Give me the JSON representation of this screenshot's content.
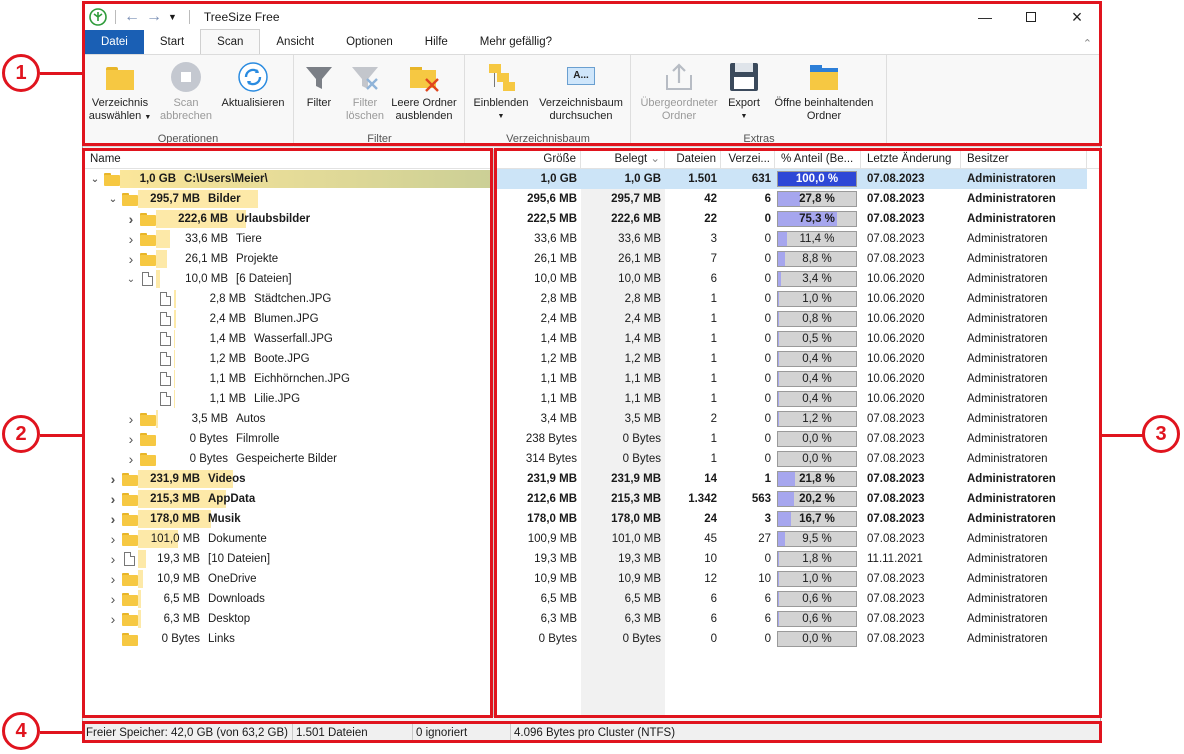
{
  "window": {
    "title": "TreeSize Free"
  },
  "tabs": [
    "Datei",
    "Start",
    "Scan",
    "Ansicht",
    "Optionen",
    "Hilfe",
    "Mehr gefällig?"
  ],
  "ribbon": {
    "groups": {
      "operationen": "Operationen",
      "filter": "Filter",
      "verzeichnisbaum": "Verzeichnisbaum",
      "extras": "Extras"
    },
    "buttons": {
      "verzeichnis_l1": "Verzeichnis",
      "verzeichnis_l2": "auswählen",
      "scan_l1": "Scan",
      "scan_l2": "abbrechen",
      "aktualisieren": "Aktualisieren",
      "filter": "Filter",
      "filter_loeschen_l1": "Filter",
      "filter_loeschen_l2": "löschen",
      "leere_l1": "Leere Ordner",
      "leere_l2": "ausblenden",
      "einblenden": "Einblenden",
      "vz_durchsuchen_l1": "Verzeichnisbaum",
      "vz_durchsuchen_l2": "durchsuchen",
      "uebergeordnet_l1": "Übergeordneter",
      "uebergeordnet_l2": "Ordner",
      "export": "Export",
      "oeffne_l1": "Öffne beinhaltenden",
      "oeffne_l2": "Ordner"
    }
  },
  "tree": {
    "header": "Name",
    "rows": [
      {
        "size": "1,0 GB",
        "name": "C:\\Users\\Meier\\",
        "bold": true
      },
      {
        "size": "295,7 MB",
        "name": "Bilder",
        "bold": true
      },
      {
        "size": "222,6 MB",
        "name": "Urlaubsbilder",
        "bold": true
      },
      {
        "size": "33,6 MB",
        "name": "Tiere"
      },
      {
        "size": "26,1 MB",
        "name": "Projekte"
      },
      {
        "size": "10,0 MB",
        "name": "[6 Dateien]"
      },
      {
        "size": "2,8 MB",
        "name": "Städtchen.JPG"
      },
      {
        "size": "2,4 MB",
        "name": "Blumen.JPG"
      },
      {
        "size": "1,4 MB",
        "name": "Wasserfall.JPG"
      },
      {
        "size": "1,2 MB",
        "name": "Boote.JPG"
      },
      {
        "size": "1,1 MB",
        "name": "Eichhörnchen.JPG"
      },
      {
        "size": "1,1 MB",
        "name": "Lilie.JPG"
      },
      {
        "size": "3,5 MB",
        "name": "Autos"
      },
      {
        "size": "0 Bytes",
        "name": "Filmrolle"
      },
      {
        "size": "0 Bytes",
        "name": "Gespeicherte Bilder"
      },
      {
        "size": "231,9 MB",
        "name": "Videos",
        "bold": true
      },
      {
        "size": "215,3 MB",
        "name": "AppData",
        "bold": true
      },
      {
        "size": "178,0 MB",
        "name": "Musik",
        "bold": true
      },
      {
        "size": "101,0 MB",
        "name": "Dokumente"
      },
      {
        "size": "19,3 MB",
        "name": "[10 Dateien]"
      },
      {
        "size": "10,9 MB",
        "name": "OneDrive"
      },
      {
        "size": "6,5 MB",
        "name": "Downloads"
      },
      {
        "size": "6,3 MB",
        "name": "Desktop"
      },
      {
        "size": "0 Bytes",
        "name": "Links"
      }
    ]
  },
  "grid": {
    "headers": [
      "Größe",
      "Belegt",
      "Dateien",
      "Verzei...",
      "% Anteil (Be...",
      "Letzte Änderung",
      "Besitzer"
    ],
    "rows": [
      [
        "1,0 GB",
        "1,0 GB",
        "1.501",
        "631",
        "100,0 %",
        "07.08.2023",
        "Administratoren"
      ],
      [
        "295,6 MB",
        "295,7 MB",
        "42",
        "6",
        "27,8 %",
        "07.08.2023",
        "Administratoren"
      ],
      [
        "222,5 MB",
        "222,6 MB",
        "22",
        "0",
        "75,3 %",
        "07.08.2023",
        "Administratoren"
      ],
      [
        "33,6 MB",
        "33,6 MB",
        "3",
        "0",
        "11,4 %",
        "07.08.2023",
        "Administratoren"
      ],
      [
        "26,1 MB",
        "26,1 MB",
        "7",
        "0",
        "8,8 %",
        "07.08.2023",
        "Administratoren"
      ],
      [
        "10,0 MB",
        "10,0 MB",
        "6",
        "0",
        "3,4 %",
        "10.06.2020",
        "Administratoren"
      ],
      [
        "2,8 MB",
        "2,8 MB",
        "1",
        "0",
        "1,0 %",
        "10.06.2020",
        "Administratoren"
      ],
      [
        "2,4 MB",
        "2,4 MB",
        "1",
        "0",
        "0,8 %",
        "10.06.2020",
        "Administratoren"
      ],
      [
        "1,4 MB",
        "1,4 MB",
        "1",
        "0",
        "0,5 %",
        "10.06.2020",
        "Administratoren"
      ],
      [
        "1,2 MB",
        "1,2 MB",
        "1",
        "0",
        "0,4 %",
        "10.06.2020",
        "Administratoren"
      ],
      [
        "1,1 MB",
        "1,1 MB",
        "1",
        "0",
        "0,4 %",
        "10.06.2020",
        "Administratoren"
      ],
      [
        "1,1 MB",
        "1,1 MB",
        "1",
        "0",
        "0,4 %",
        "10.06.2020",
        "Administratoren"
      ],
      [
        "3,4 MB",
        "3,5 MB",
        "2",
        "0",
        "1,2 %",
        "07.08.2023",
        "Administratoren"
      ],
      [
        "238 Bytes",
        "0 Bytes",
        "1",
        "0",
        "0,0 %",
        "07.08.2023",
        "Administratoren"
      ],
      [
        "314 Bytes",
        "0 Bytes",
        "1",
        "0",
        "0,0 %",
        "07.08.2023",
        "Administratoren"
      ],
      [
        "231,9 MB",
        "231,9 MB",
        "14",
        "1",
        "21,8 %",
        "07.08.2023",
        "Administratoren"
      ],
      [
        "212,6 MB",
        "215,3 MB",
        "1.342",
        "563",
        "20,2 %",
        "07.08.2023",
        "Administratoren"
      ],
      [
        "178,0 MB",
        "178,0 MB",
        "24",
        "3",
        "16,7 %",
        "07.08.2023",
        "Administratoren"
      ],
      [
        "100,9 MB",
        "101,0 MB",
        "45",
        "27",
        "9,5 %",
        "07.08.2023",
        "Administratoren"
      ],
      [
        "19,3 MB",
        "19,3 MB",
        "10",
        "0",
        "1,8 %",
        "11.11.2021",
        "Administratoren"
      ],
      [
        "10,9 MB",
        "10,9 MB",
        "12",
        "10",
        "1,0 %",
        "07.08.2023",
        "Administratoren"
      ],
      [
        "6,5 MB",
        "6,5 MB",
        "6",
        "6",
        "0,6 %",
        "07.08.2023",
        "Administratoren"
      ],
      [
        "6,3 MB",
        "6,3 MB",
        "6",
        "6",
        "0,6 %",
        "07.08.2023",
        "Administratoren"
      ],
      [
        "0 Bytes",
        "0 Bytes",
        "0",
        "0",
        "0,0 %",
        "07.08.2023",
        "Administratoren"
      ]
    ]
  },
  "status": {
    "free": "Freier Speicher: 42,0 GB  (von 63,2 GB)",
    "files": "1.501 Dateien",
    "ignored": "0 ignoriert",
    "cluster": "4.096 Bytes pro Cluster (NTFS)"
  },
  "callouts": [
    "1",
    "2",
    "3",
    "4"
  ],
  "colors": {
    "callout": "#e0141e",
    "accent": "#1a5fb4",
    "selection": "#cce4f7"
  }
}
